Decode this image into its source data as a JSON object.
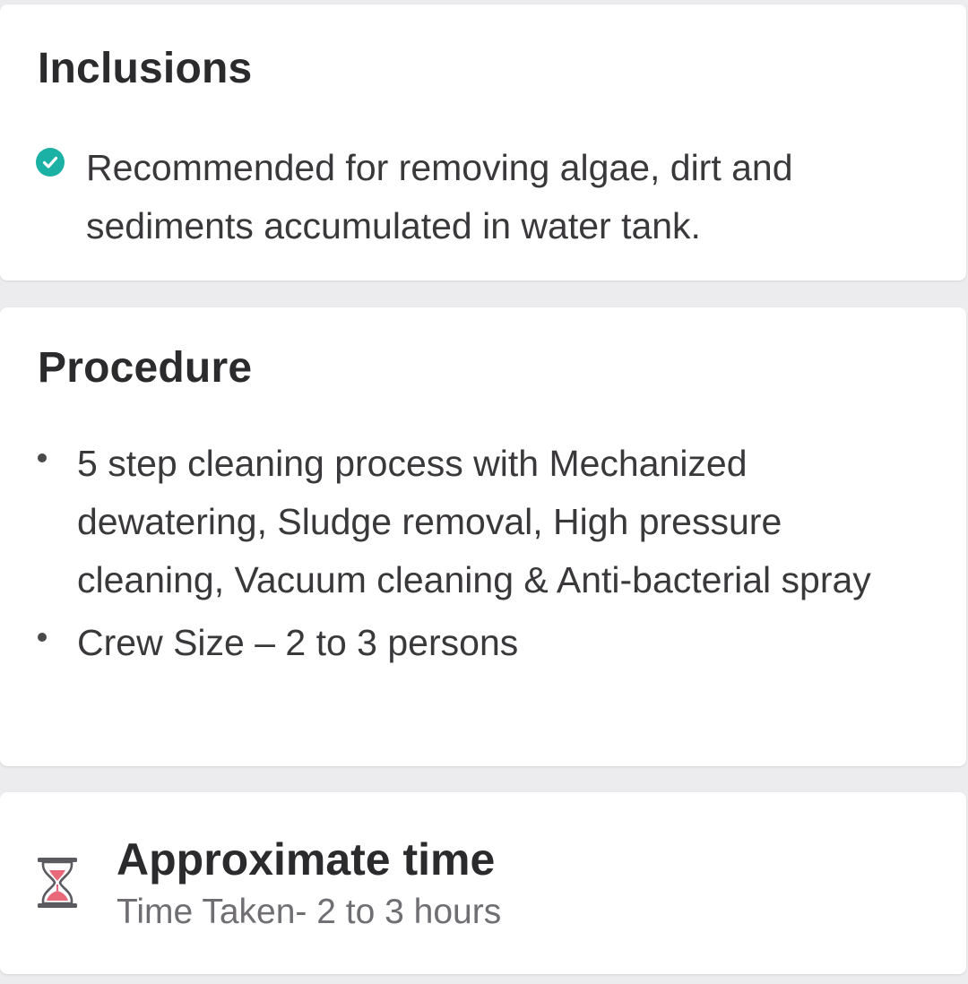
{
  "inclusions": {
    "title": "Inclusions",
    "items": [
      {
        "icon": "check-circle-icon",
        "text": "Recommended for removing algae, dirt and sediments accumulated in water tank."
      }
    ]
  },
  "procedure": {
    "title": "Procedure",
    "items": [
      "5 step cleaning process with Mechanized dewatering, Sludge removal, High pressure cleaning, Vacuum cleaning & Anti-bacterial spray",
      "Crew Size – 2 to 3 persons"
    ]
  },
  "approximate_time": {
    "icon": "hourglass-icon",
    "title": "Approximate time",
    "subtitle": "Time Taken- 2 to 3 hours"
  },
  "colors": {
    "check_accent": "#1bb1a5",
    "hourglass_sand": "#e8697a",
    "background": "#ececee",
    "card": "#ffffff"
  }
}
